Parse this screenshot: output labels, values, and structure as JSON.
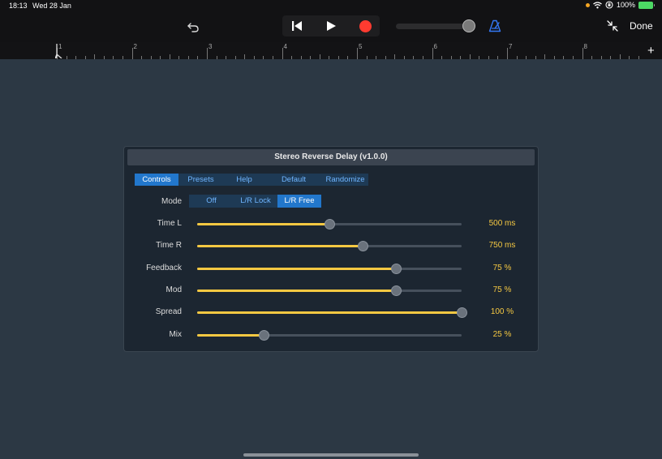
{
  "status_bar": {
    "time": "18:13",
    "date": "Wed 28 Jan",
    "battery": "100%",
    "icons": [
      "orange-dot",
      "wifi-icon",
      "orientation-lock-icon",
      "battery-icon"
    ]
  },
  "toolbar": {
    "icons": [
      "undo-icon",
      "rewind-icon",
      "play-icon",
      "record-icon",
      "metronome-icon",
      "collapse-icon"
    ],
    "volume_level": 0.98,
    "done_label": "Done",
    "accent_color": "#3478f6",
    "record_color": "#ff3b30"
  },
  "ruler": {
    "marks": [
      "1",
      "2",
      "3",
      "4",
      "5",
      "6",
      "7",
      "8"
    ],
    "add_label": "+"
  },
  "plugin": {
    "title": "Stereo Reverse Delay (v1.0.0)",
    "tabs": [
      "Controls",
      "Presets",
      "Help",
      "Default",
      "Randomize"
    ],
    "active_tab": "Controls",
    "mode": {
      "label": "Mode",
      "options": [
        "Off",
        "L/R Lock",
        "L/R Free"
      ],
      "selected": "L/R Free"
    },
    "params": [
      {
        "label": "Time L",
        "value": "500 ms",
        "level": 0.5
      },
      {
        "label": "Time R",
        "value": "750 ms",
        "level": 0.625
      },
      {
        "label": "Feedback",
        "value": "75 %",
        "level": 0.75
      },
      {
        "label": "Mod",
        "value": "75 %",
        "level": 0.75
      },
      {
        "label": "Spread",
        "value": "100 %",
        "level": 1.0
      },
      {
        "label": "Mix",
        "value": "25 %",
        "level": 0.25
      }
    ],
    "accent_color": "#f5c842"
  }
}
